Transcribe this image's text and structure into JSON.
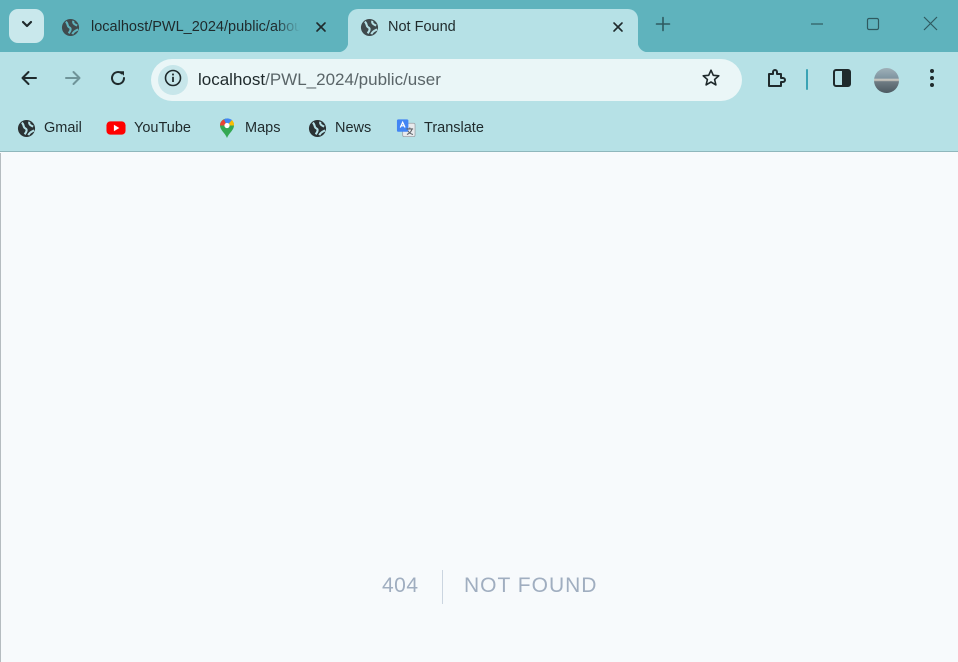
{
  "tabs": [
    {
      "title": "localhost/PWL_2024/public/about",
      "active": false,
      "icon": "globe-icon"
    },
    {
      "title": "Not Found",
      "active": true,
      "icon": "globe-icon"
    }
  ],
  "toolbar": {
    "url_host": "localhost",
    "url_path": "/PWL_2024/public/user"
  },
  "bookmarks": [
    {
      "label": "Gmail",
      "icon": "globe-icon"
    },
    {
      "label": "YouTube",
      "icon": "youtube-icon"
    },
    {
      "label": "Maps",
      "icon": "maps-pin-icon"
    },
    {
      "label": "News",
      "icon": "globe-icon"
    },
    {
      "label": "Translate",
      "icon": "translate-icon"
    }
  ],
  "page": {
    "status_code": "404",
    "status_message": "NOT FOUND"
  },
  "colors": {
    "tabstrip": "#5fb3bd",
    "toolbar": "#b6e1e6",
    "page_background": "#f7fafc",
    "error_text": "#a0aec0"
  }
}
